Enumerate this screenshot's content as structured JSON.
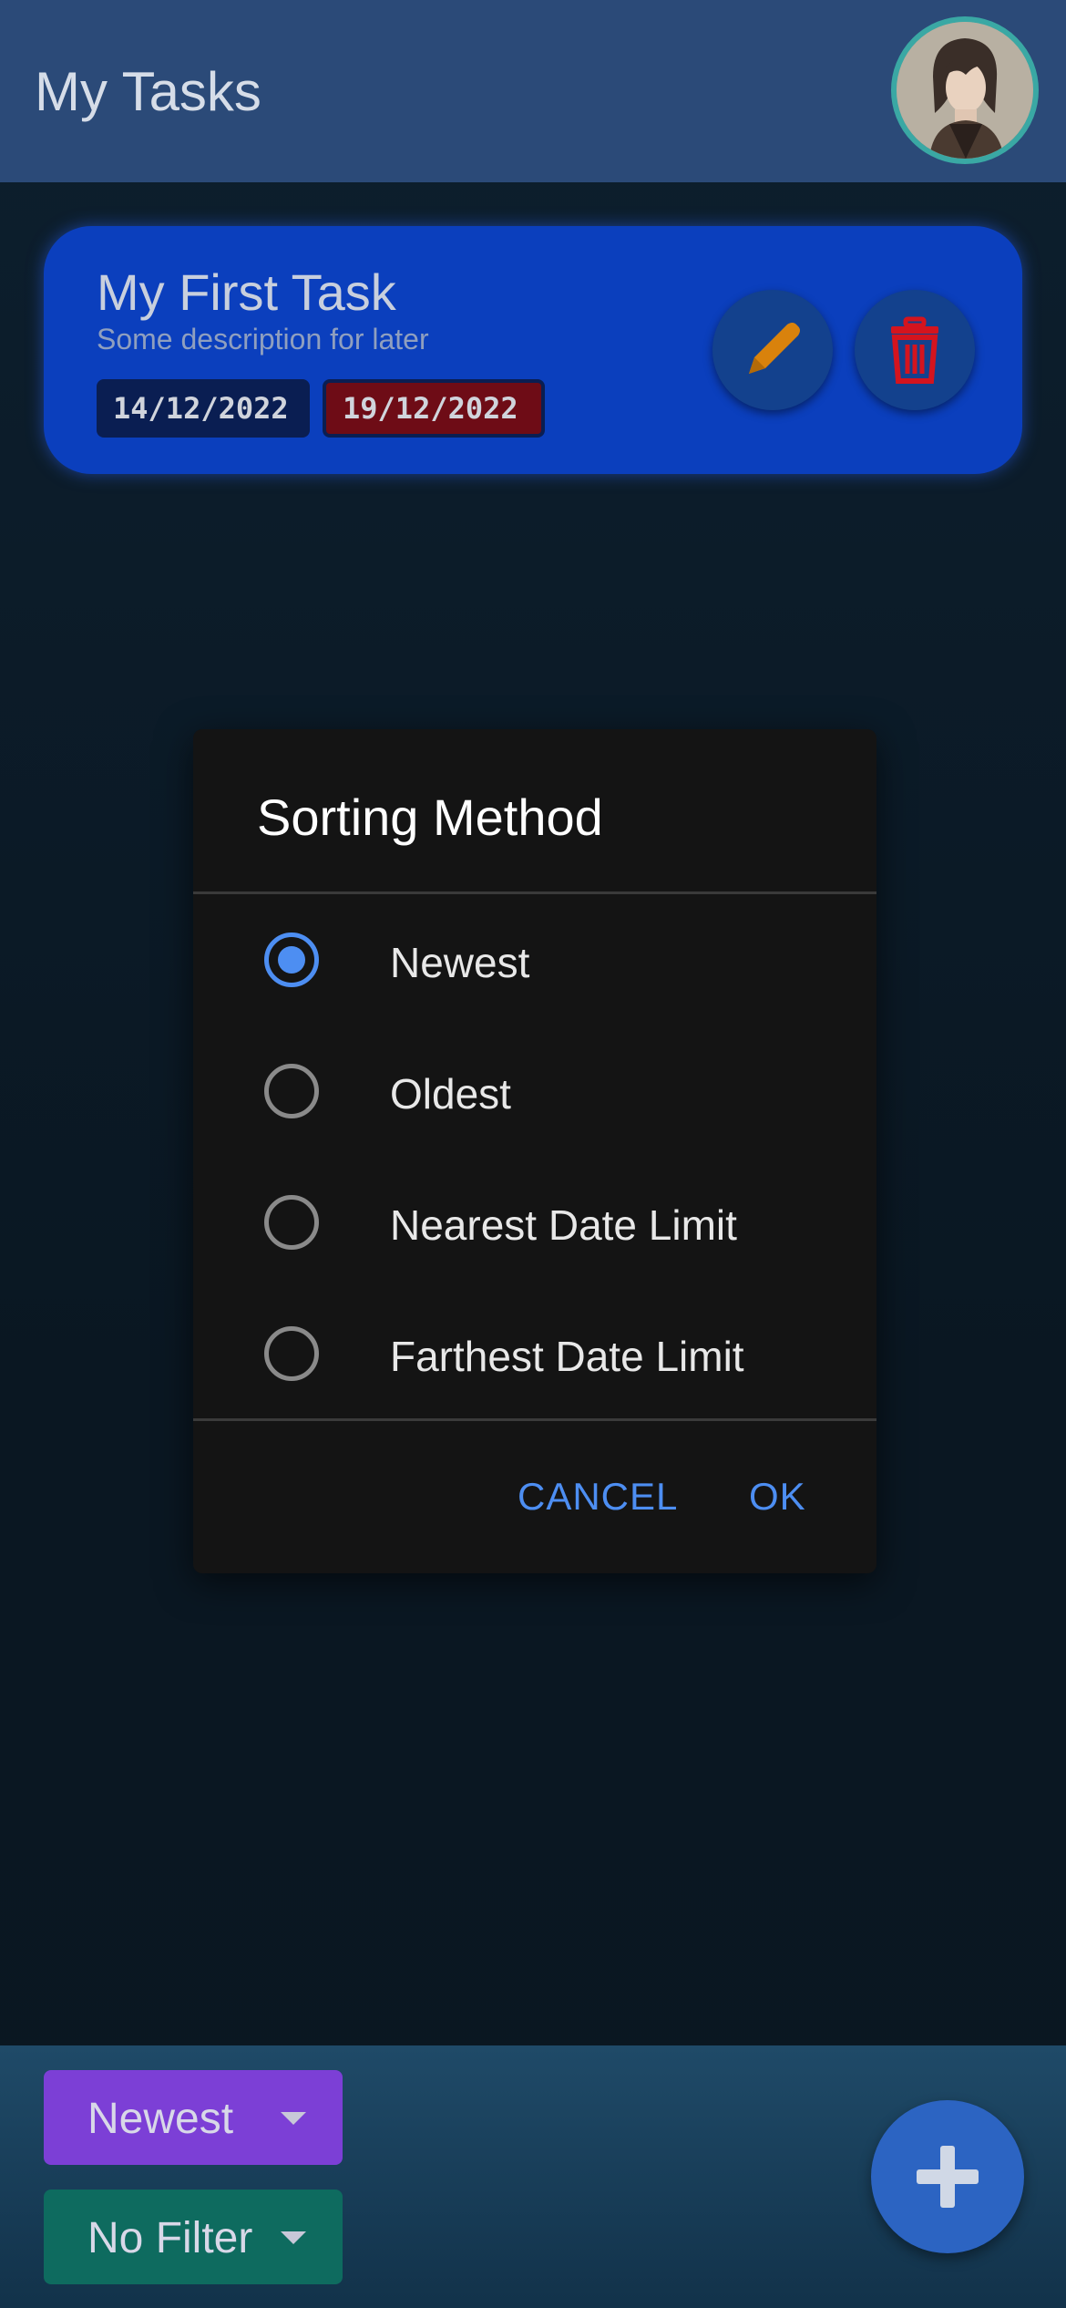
{
  "app_bar": {
    "title": "My Tasks"
  },
  "task": {
    "title": "My First Task",
    "description": "Some description for later",
    "start_date": "14/12/2022",
    "due_date": "19/12/2022"
  },
  "dialog": {
    "title": "Sorting Method",
    "options": [
      {
        "label": "Newest",
        "selected": true
      },
      {
        "label": "Oldest",
        "selected": false
      },
      {
        "label": "Nearest Date Limit",
        "selected": false
      },
      {
        "label": "Farthest Date Limit",
        "selected": false
      }
    ],
    "cancel_label": "CANCEL",
    "ok_label": "OK"
  },
  "bottom_bar": {
    "sort_value": "Newest",
    "filter_value": "No Filter"
  },
  "icons": {
    "avatar": "avatar-image",
    "edit": "pencil-icon",
    "delete": "trash-icon",
    "add": "plus-icon",
    "dropdown": "chevron-down-icon"
  },
  "colors": {
    "accent": "#4d8ef2",
    "card": "#0b3fbd",
    "due_date_chip": "#6e0c16",
    "sort_dropdown": "#7c3fd6",
    "filter_dropdown": "#0e6b5f"
  }
}
